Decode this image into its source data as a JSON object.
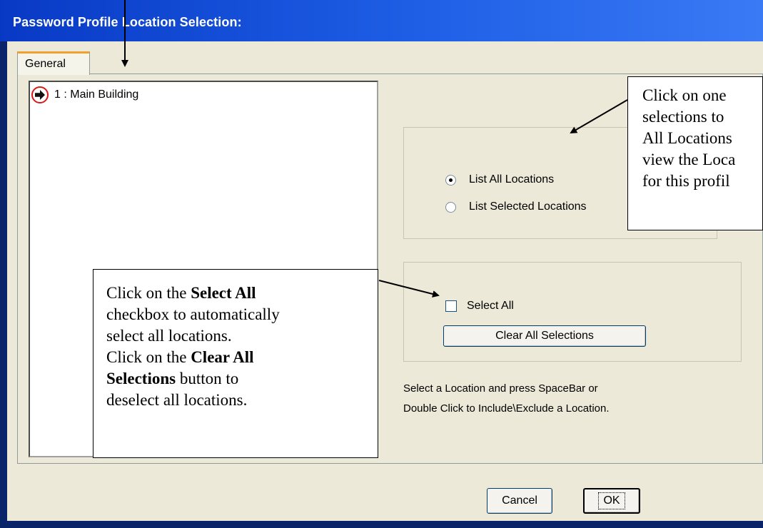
{
  "window": {
    "title": "Password Profile Location Selection:"
  },
  "tabs": [
    {
      "label": "General"
    }
  ],
  "location_list": {
    "items": [
      {
        "label": "1 : Main Building",
        "icon": "include-arrow-icon"
      }
    ]
  },
  "view_options": {
    "options": [
      {
        "label": "List All Locations",
        "selected": true
      },
      {
        "label": "List Selected Locations",
        "selected": false
      }
    ]
  },
  "selection_group": {
    "select_all_label": "Select All",
    "select_all_checked": false,
    "clear_all_label": "Clear All Selections"
  },
  "help_text": {
    "line1": "Select a Location and press SpaceBar or",
    "line2": "Double Click to Include\\Exclude a Location."
  },
  "buttons": {
    "cancel": "Cancel",
    "ok": "OK"
  },
  "callouts": {
    "radio_callout": {
      "lines": [
        "Click on one",
        "selections to",
        "All Locations",
        "view the Loca",
        "for this profil"
      ]
    },
    "select_all_callout": {
      "line1": "Click on the ",
      "line1_bold": "Select All",
      "line2": "checkbox to automatically",
      "line3": "select all locations.",
      "line4": "Click on the ",
      "line4_bold": "Clear All",
      "line5_bold": "Selections",
      "line5": " button to",
      "line6": "deselect all locations."
    }
  },
  "colors": {
    "title_bar": "#0839c5",
    "dialog_face": "#ece9d8",
    "tab_highlight": "#f0a030"
  }
}
